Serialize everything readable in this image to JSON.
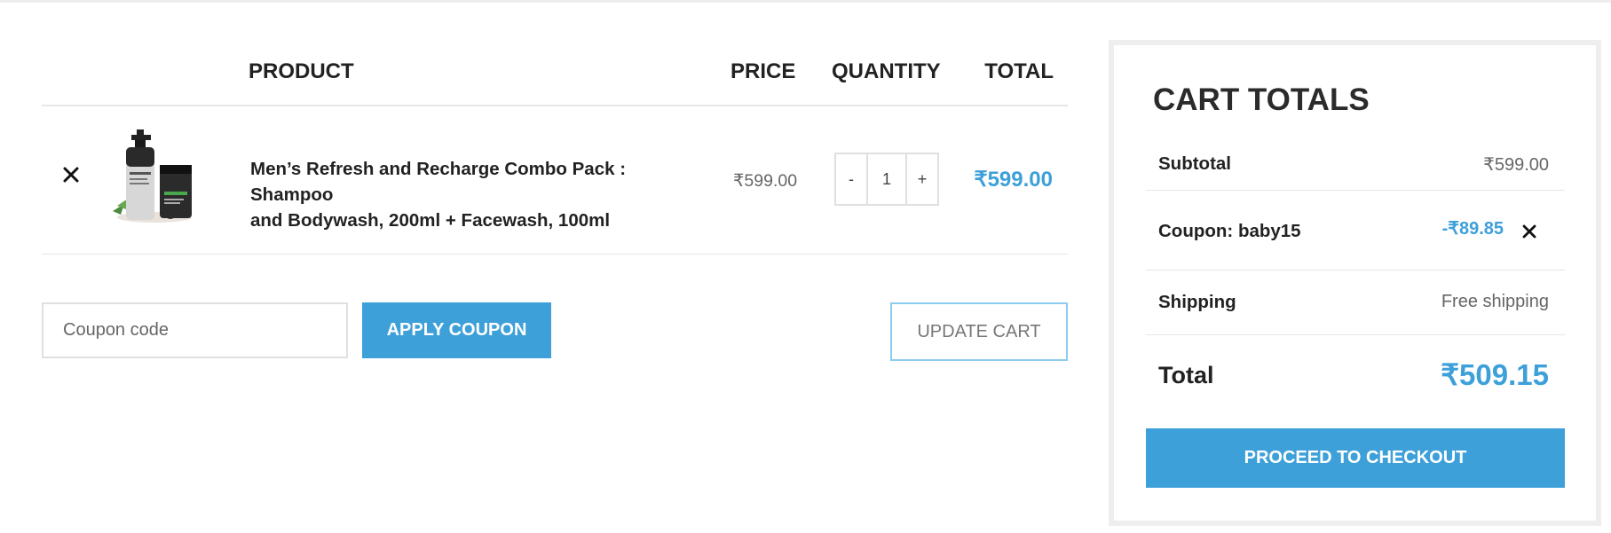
{
  "cart": {
    "headers": {
      "product": "PRODUCT",
      "price": "PRICE",
      "quantity": "QUANTITY",
      "total": "TOTAL"
    },
    "item": {
      "name_line1": "Men’s Refresh and Recharge Combo Pack : Shampoo",
      "name_line2": "and Bodywash, 200ml + Facewash, 100ml",
      "price": "₹599.00",
      "qty_minus": "-",
      "quantity": "1",
      "qty_plus": "+",
      "total": "₹599.00"
    },
    "coupon_placeholder": "Coupon code",
    "apply_coupon_label": "APPLY COUPON",
    "update_cart_label": "UPDATE CART"
  },
  "totals": {
    "title": "CART TOTALS",
    "subtotal_label": "Subtotal",
    "subtotal_value": "₹599.00",
    "coupon_label": "Coupon: baby15",
    "coupon_value": "-₹89.85",
    "shipping_label": "Shipping",
    "shipping_value": "Free shipping",
    "total_label": "Total",
    "total_value": "₹509.15",
    "checkout_label": "PROCEED TO CHECKOUT"
  },
  "colors": {
    "accent": "#3ea0d9",
    "accent_light": "#8ccbee",
    "border": "#e6e6e6"
  },
  "icons": {
    "remove_item": "close-icon",
    "remove_coupon": "close-icon"
  }
}
